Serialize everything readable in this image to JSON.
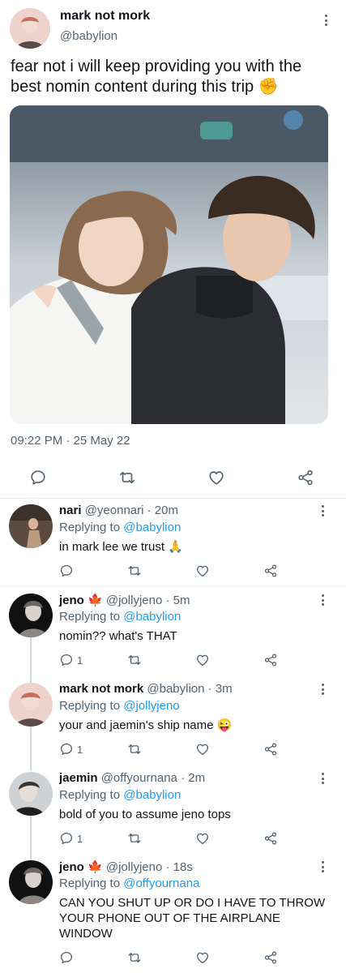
{
  "main_tweet": {
    "display_name": "mark not mork",
    "handle": "@babylion",
    "text": "fear not i will keep providing you with the best nomin content during this trip ✊",
    "timestamp": "09:22 PM · 25 May 22"
  },
  "replies": [
    {
      "display_name": "nari",
      "handle": "@yeonnari",
      "time": "· 20m",
      "replying_prefix": "Replying to",
      "replying_to": "@babylion",
      "text": "in mark lee we trust 🙏",
      "reply_count": ""
    },
    {
      "display_name": "jeno",
      "badge": "🍁",
      "handle": "@jollyjeno",
      "time": "· 5m",
      "replying_prefix": "Replying to",
      "replying_to": "@babylion",
      "text": "nomin?? what's THAT",
      "reply_count": "1"
    },
    {
      "display_name": "mark not mork",
      "handle": "@babylion",
      "time": "· 3m",
      "replying_prefix": "Replying to",
      "replying_to": "@jollyjeno",
      "text": "your and jaemin's ship name 😜",
      "reply_count": "1"
    },
    {
      "display_name": "jaemin",
      "handle": "@offyournana",
      "time": "· 2m",
      "replying_prefix": "Replying to",
      "replying_to": "@babylion",
      "text": "bold of you to assume jeno tops",
      "reply_count": "1"
    },
    {
      "display_name": "jeno",
      "badge": "🍁",
      "handle": "@jollyjeno",
      "time": "· 18s",
      "replying_prefix": "Replying to",
      "replying_to": "@offyournana",
      "text": "CAN YOU SHUT UP OR DO I HAVE TO THROW YOUR PHONE OUT OF THE AIRPLANE WINDOW",
      "reply_count": ""
    }
  ],
  "icons": [
    "reply-icon",
    "retweet-icon",
    "like-icon",
    "share-icon",
    "more-icon"
  ],
  "colors": {
    "link": "#1d9bf0",
    "muted": "#536471",
    "divider": "#e6ecf0"
  }
}
